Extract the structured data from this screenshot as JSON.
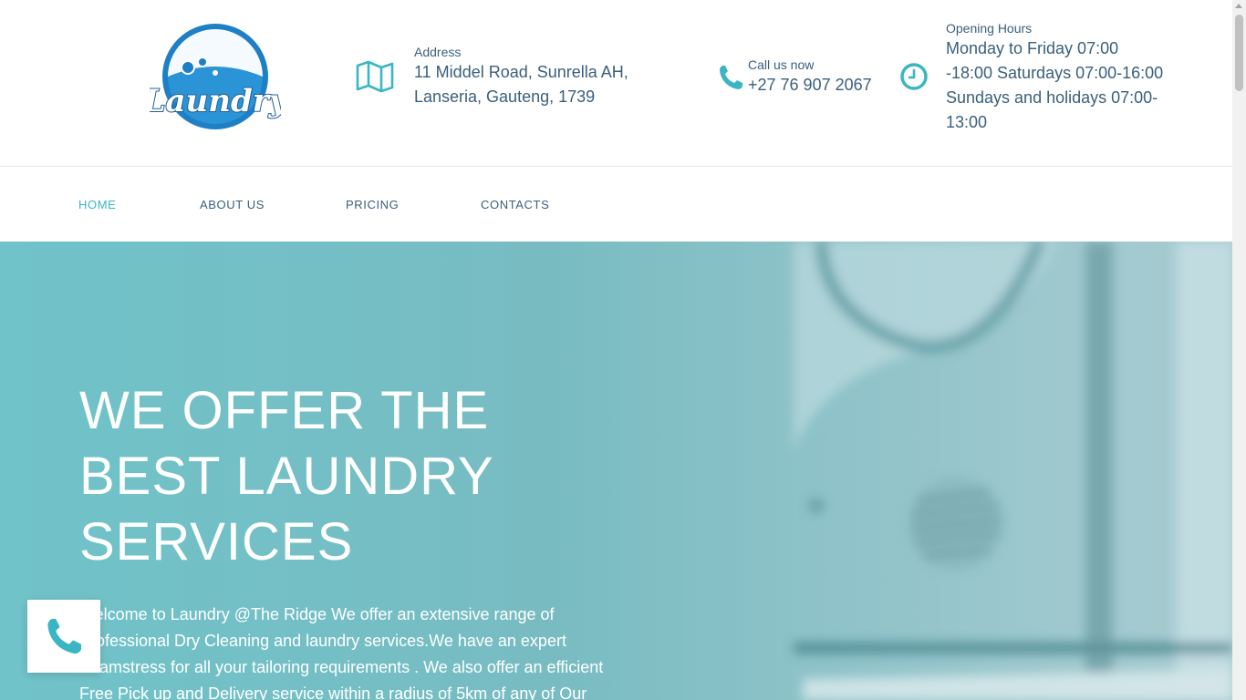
{
  "header": {
    "logo_text": "Laundry",
    "address": {
      "label": "Address",
      "value": "11 Middel Road, Sunrella AH, Lanseria, Gauteng, 1739"
    },
    "call": {
      "label": "Call us now",
      "value": "+27 76 907 2067"
    },
    "hours": {
      "label": "Opening Hours",
      "value": "Monday to Friday 07:00 -18:00 Saturdays 07:00-16:00 Sundays and holidays 07:00-13:00"
    }
  },
  "nav": {
    "items": [
      {
        "label": "HOME",
        "active": true
      },
      {
        "label": "ABOUT US"
      },
      {
        "label": "PRICING"
      },
      {
        "label": "CONTACTS"
      }
    ]
  },
  "hero": {
    "title": "WE OFFER THE BEST LAUNDRY SERVICES",
    "text": "Welcome to Laundry @The Ridge We offer an extensive range of Professional Dry Cleaning and laundry services.We have an expert Seamstress for all your tailoring requirements . We also offer an efficient Free Pick up and Delivery service within a radius of 5km of any of Our"
  },
  "colors": {
    "accent": "#3ab5c4",
    "text": "#3a5f7d",
    "hero_bg": "#78bcc2",
    "logo_blue": "#1f7fc4"
  },
  "icons": {
    "address": "map-icon",
    "call": "phone-icon",
    "hours": "clock-icon",
    "float": "phone-icon"
  }
}
